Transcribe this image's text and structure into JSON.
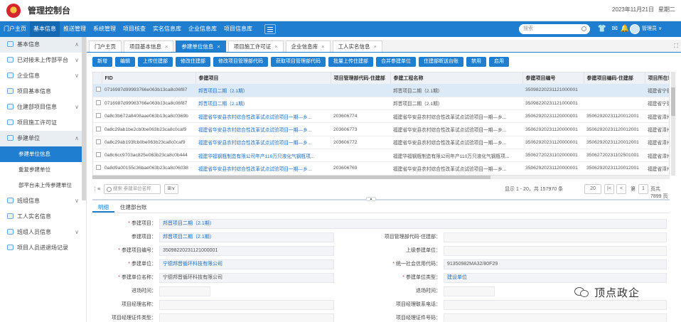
{
  "app": {
    "title": "管理控制台",
    "date": "2023年11月21日",
    "weekday": "星期二"
  },
  "nav": {
    "items": [
      "门户主页",
      "基本信息",
      "推送管理",
      "系统管理",
      "项目核查",
      "实名信息库",
      "企业信息库",
      "项目信息库"
    ],
    "search_placeholder": "搜索",
    "user": "管理员 ∨"
  },
  "sidebar": [
    {
      "label": "基本信息",
      "type": "group",
      "chevron": "∧"
    },
    {
      "label": "已对接未上传部平台",
      "type": "item",
      "chevron": "∨"
    },
    {
      "label": "企业信息",
      "type": "item",
      "chevron": "∨"
    },
    {
      "label": "项目基本信息",
      "type": "item",
      "chevron": ""
    },
    {
      "label": "住建部项目信息",
      "type": "item",
      "chevron": "∨"
    },
    {
      "label": "项目施工许可证",
      "type": "item",
      "chevron": ""
    },
    {
      "label": "参建单位",
      "type": "group",
      "chevron": "∧"
    },
    {
      "label": "参建单位信息",
      "type": "active",
      "chevron": ""
    },
    {
      "label": "重复参建单位",
      "type": "sub",
      "chevron": ""
    },
    {
      "label": "部平台未上传参建单位",
      "type": "sub",
      "chevron": ""
    },
    {
      "label": "班组信息",
      "type": "item",
      "chevron": "∨"
    },
    {
      "label": "工人实名信息",
      "type": "item",
      "chevron": ""
    },
    {
      "label": "班组人员信息",
      "type": "item",
      "chevron": "∨"
    },
    {
      "label": "项目人员进退场记录",
      "type": "item",
      "chevron": ""
    }
  ],
  "tabs": [
    "门户主页",
    "项目基本信息",
    "参建单位信息",
    "项目施工许可证",
    "企业信息库",
    "工人实名信息"
  ],
  "active_tab": 2,
  "toolbar": [
    "新增",
    "编辑",
    "上传住建部",
    "修改住建部",
    "修改项目管理部代码",
    "获取项目管理部代码",
    "批量上传住建部",
    "合并参建单位",
    "住建部断送台账",
    "禁用",
    "启用"
  ],
  "table": {
    "columns": [
      "FID",
      "参建项目",
      "项目管理部代码-住建部",
      "参建工程名称",
      "参建项目编号",
      "参建项目编码-住建部",
      "项目所在地"
    ],
    "rows": [
      [
        "0716987d99993766e063b13ca8c06f87",
        "邦晋项目二期（2.1期）",
        "",
        "邦晋项目二期（2.1期）",
        "350982202311210000​01",
        "",
        "福建省宁德市"
      ],
      [
        "0716987d99963766e063b13ca8c06f87",
        "邦晋项目二期（2.1期）",
        "",
        "邦晋项目二期（2.1期）",
        "350982202311210000​01",
        "",
        "福建省宁德市"
      ],
      [
        "0a8c3b672a8408aae063b13ca8c0369b",
        "福建省华安县农村综合性改革试点试验项目一期—乡...",
        "203606774",
        "福建省华安县农村综合性改革试点试验项目一期—乡...",
        "350629202311200000​01",
        "350629202311200120​01",
        "福建省漳州市"
      ],
      [
        "0a8c29ab1be2cb0be063b23ca8c0caf9",
        "福建省华安县农村综合性改革试点试验项目一期—乡...",
        "203606773",
        "福建省华安县农村综合性改革试点试验项目一期—乡...",
        "350629202311200000​01",
        "350629202311200120​01",
        "福建省漳州市"
      ],
      [
        "0a8c29ab193fcb0be063b23ca8c0caf9",
        "福建省华安县农村综合性改革试点试验项目一期—乡...",
        "203606772",
        "福建省华安县农村综合性改革试点试验项目一期—乡...",
        "350629202311200000​01",
        "350629202311200120​01",
        "福建省漳州市"
      ],
      [
        "0a8c6cc9703ac825e063b23ca8c0b444",
        "福建华福钢瓶制造有限公司年产110万只液化气钢瓶项...",
        "",
        "福建华福钢瓶制造有限公司年产110万只液化气钢瓶项...",
        "350627202311020000​01",
        "350627202311025010​01",
        "福建省漳州市"
      ],
      [
        "0a8d9a00155c36bae063b23ca8c06038",
        "福建省华安县农村综合性改革试点试验项目一期—乡...",
        "203606769",
        "福建省华安县农村综合性改革试点试验项目一期—乡...",
        "350629202311200000​01",
        "350629202311200120​01",
        "福建省漳州市"
      ]
    ],
    "selected_row": 0
  },
  "pager": {
    "search_placeholder": "搜索 参建单位名称",
    "info": "显示 1 - 20，共 157970 条",
    "page_size": "20",
    "first": "|<",
    "prev": "<",
    "page_label_before": "第",
    "page": "1",
    "page_label_after": "页共 7899 页",
    "next": ">",
    "last": ">|"
  },
  "detail_tabs": [
    "明细",
    "住建部台账"
  ],
  "form": [
    {
      "label": "参建项目",
      "required": true,
      "value": "邦晋项目二期（2.1期）",
      "link": true,
      "col": "left-wide"
    },
    {
      "label": "参建项目",
      "required": false,
      "value": "邦晋项目二期（2.1期）",
      "link": true,
      "col": "left"
    },
    {
      "label": "项目管理部代码-住建部",
      "required": false,
      "value": "",
      "link": false,
      "col": "right"
    },
    {
      "label": "参建项目编号",
      "required": true,
      "value": "350982202311210000​01",
      "link": false,
      "col": "left"
    },
    {
      "label": "上级参建单位",
      "required": false,
      "value": "",
      "link": false,
      "col": "right"
    },
    {
      "label": "参建单位",
      "required": true,
      "value": "宁德邦晋循环科技有限公司",
      "link": true,
      "col": "left"
    },
    {
      "label": "统一社会信用代码",
      "required": true,
      "value": "91350982MA32/80F29",
      "link": false,
      "col": "right"
    },
    {
      "label": "参建单位名称",
      "required": true,
      "value": "宁德邦晋循环科技有限公司",
      "link": false,
      "col": "left"
    },
    {
      "label": "参建单位类型",
      "required": true,
      "value": "建设单位",
      "link": true,
      "col": "right"
    },
    {
      "label": "进场时间",
      "required": false,
      "value": "",
      "link": false,
      "col": "left-short"
    },
    {
      "label": "退场时间",
      "required": false,
      "value": "",
      "link": false,
      "col": "right-short"
    },
    {
      "label": "项目经理名称",
      "required": false,
      "value": "",
      "link": false,
      "col": "left"
    },
    {
      "label": "项目经理联系电话",
      "required": false,
      "value": "",
      "link": false,
      "col": "right"
    },
    {
      "label": "项目经理证件类型",
      "required": false,
      "value": "",
      "link": false,
      "col": "left"
    },
    {
      "label": "项目经理证件号码",
      "required": false,
      "value": "",
      "link": false,
      "col": "right"
    }
  ],
  "watermark": "顶点政企",
  "colors": {
    "primary": "#1f7ed0",
    "nav": "#1f7ed0",
    "link": "#1f6fc0",
    "required": "#d9383a",
    "selected_row": "#dceaf8"
  }
}
